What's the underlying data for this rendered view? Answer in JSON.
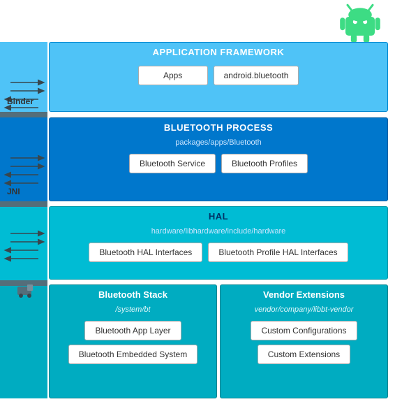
{
  "diagram": {
    "android_logo_color": "#3ddc84",
    "sections": {
      "app_framework": {
        "title": "APPLICATION FRAMEWORK",
        "boxes": [
          "Apps",
          "android.bluetooth"
        ]
      },
      "binder_label": "Binder",
      "jni_label": "JNI",
      "bt_process": {
        "title": "BLUETOOTH PROCESS",
        "sublabel": "packages/apps/Bluetooth",
        "boxes": [
          "Bluetooth Service",
          "Bluetooth Profiles"
        ]
      },
      "hal": {
        "title": "HAL",
        "sublabel": "hardware/libhardware/include/hardware",
        "boxes": [
          "Bluetooth HAL Interfaces",
          "Bluetooth Profile HAL Interfaces"
        ]
      },
      "bt_stack": {
        "title": "Bluetooth Stack",
        "sublabel": "/system/bt",
        "boxes": [
          "Bluetooth App Layer",
          "Bluetooth Embedded System"
        ]
      },
      "vendor_ext": {
        "title": "Vendor Extensions",
        "sublabel": "vendor/company/libbt-vendor",
        "boxes": [
          "Custom Configurations",
          "Custom Extensions"
        ]
      }
    }
  }
}
